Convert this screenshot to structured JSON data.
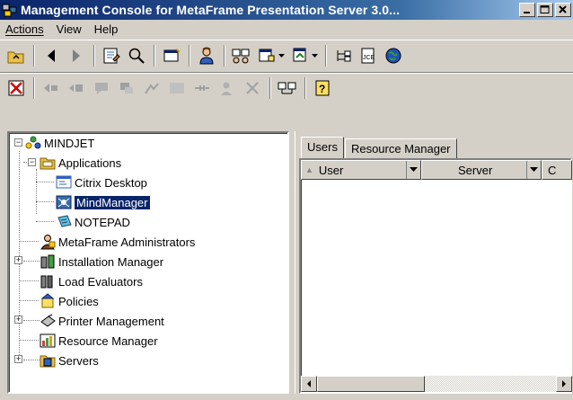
{
  "window": {
    "title": "Management Console for MetaFrame Presentation Server 3.0..."
  },
  "menu": [
    "Actions",
    "View",
    "Help"
  ],
  "tree": {
    "root": "MINDJET",
    "applications": "Applications",
    "apps": [
      "Citrix Desktop",
      "MindManager",
      "NOTEPAD"
    ],
    "nodes": [
      "MetaFrame Administrators",
      "Installation Manager",
      "Load Evaluators",
      "Policies",
      "Printer Management",
      "Resource Manager",
      "Servers"
    ],
    "selected": "MindManager"
  },
  "tabs": [
    "Users",
    "Resource Manager"
  ],
  "columns": [
    "User",
    "Server",
    "C"
  ],
  "colors": {
    "title_start": "#0a246a",
    "title_end": "#a6caf0",
    "selection": "#0a246a",
    "face": "#d4d0c8"
  }
}
